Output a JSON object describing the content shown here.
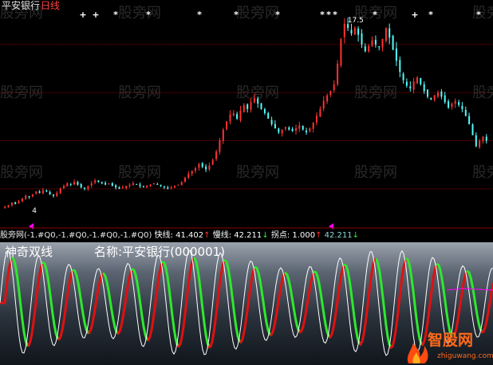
{
  "header": {
    "stock_name": "平安银行",
    "period": "日线"
  },
  "indicator_status": {
    "source_label": "股旁网",
    "params": "(-1.#Q0,-1.#Q0,-1.#Q0,-1.#Q0)",
    "fast_label": "快线:",
    "fast_value": "41.402",
    "slow_label": "慢线:",
    "slow_value": "42.211",
    "turn_label": "拐点:",
    "turn_value": "1.000",
    "extra_value": "42.211",
    "arrow_up": "↑",
    "arrow_down": "↓"
  },
  "banner": {
    "title": "神奇双线",
    "name_label": "名称:",
    "name_value": "平安银行(000001)"
  },
  "watermark": {
    "text": "股旁网",
    "logo_text": "智股网",
    "logo_sub": "zhiguwang.com"
  },
  "annotations": {
    "high_label": "17.5",
    "low_label": "4",
    "star_glyph": "*",
    "plus_glyph": "+"
  },
  "colors": {
    "background": "#000000",
    "up_candle": "#ff3232",
    "down_candle": "#54fcfc",
    "flat_candle": "#ffffff",
    "grid": "#8b0000",
    "fast_line": "#ffffff",
    "slow_line_up": "#e01010",
    "slow_line_down": "#2ee82e",
    "turn_line": "#ff00ff",
    "extra_value": "#8ad8d8",
    "status_text": "#e8e8e8"
  },
  "chart_data": [
    {
      "type": "candlestick",
      "title": "平安银行 日线",
      "ylim": [
        3,
        19
      ],
      "grid": true,
      "high_marker": 17.5,
      "low_marker": 4,
      "series": [
        {
          "name": "平安银行",
          "close": [
            4.2,
            4.3,
            4.5,
            4.4,
            4.6,
            4.8,
            5.0,
            4.9,
            5.1,
            5.3,
            5.2,
            5.4,
            5.3,
            5.1,
            5.0,
            5.2,
            5.5,
            5.7,
            5.9,
            5.8,
            6.0,
            5.8,
            5.6,
            5.5,
            5.7,
            5.9,
            6.1,
            6.0,
            5.9,
            5.8,
            5.9,
            5.7,
            5.6,
            5.5,
            5.6,
            5.7,
            5.8,
            5.9,
            5.8,
            5.7,
            5.6,
            5.7,
            5.8,
            5.9,
            5.8,
            5.7,
            5.6,
            5.5,
            5.6,
            5.7,
            5.8,
            6.0,
            6.3,
            6.6,
            6.8,
            7.0,
            7.3,
            7.1,
            6.9,
            7.2,
            7.6,
            8.2,
            9.0,
            9.8,
            10.4,
            10.9,
            11.0,
            10.6,
            11.2,
            11.6,
            11.3,
            11.8,
            12.1,
            11.7,
            11.3,
            11.0,
            10.6,
            10.2,
            9.9,
            9.6,
            9.8,
            10.0,
            9.8,
            9.7,
            9.9,
            10.1,
            9.8,
            9.6,
            9.9,
            10.3,
            10.8,
            11.3,
            11.9,
            12.3,
            12.6,
            13.1,
            14.6,
            16.4,
            17.5,
            17.2,
            16.8,
            17.2,
            16.7,
            16.0,
            15.5,
            15.9,
            16.3,
            16.0,
            15.8,
            16.4,
            17.2,
            16.5,
            15.6,
            14.8,
            14.0,
            13.4,
            13.0,
            12.8,
            13.3,
            13.6,
            13.1,
            12.6,
            12.2,
            12.0,
            12.3,
            12.5,
            12.2,
            11.8,
            11.4,
            11.7,
            11.9,
            11.6,
            11.3,
            10.8,
            10.2,
            9.4,
            8.6,
            9.0,
            9.3,
            9.0
          ]
        }
      ]
    },
    {
      "type": "line",
      "title": "神奇双线",
      "ylim": [
        0,
        100
      ],
      "series": [
        {
          "name": "快线",
          "last": 41.402
        },
        {
          "name": "慢线",
          "last": 42.211
        },
        {
          "name": "拐点",
          "last": 1.0
        }
      ]
    }
  ]
}
